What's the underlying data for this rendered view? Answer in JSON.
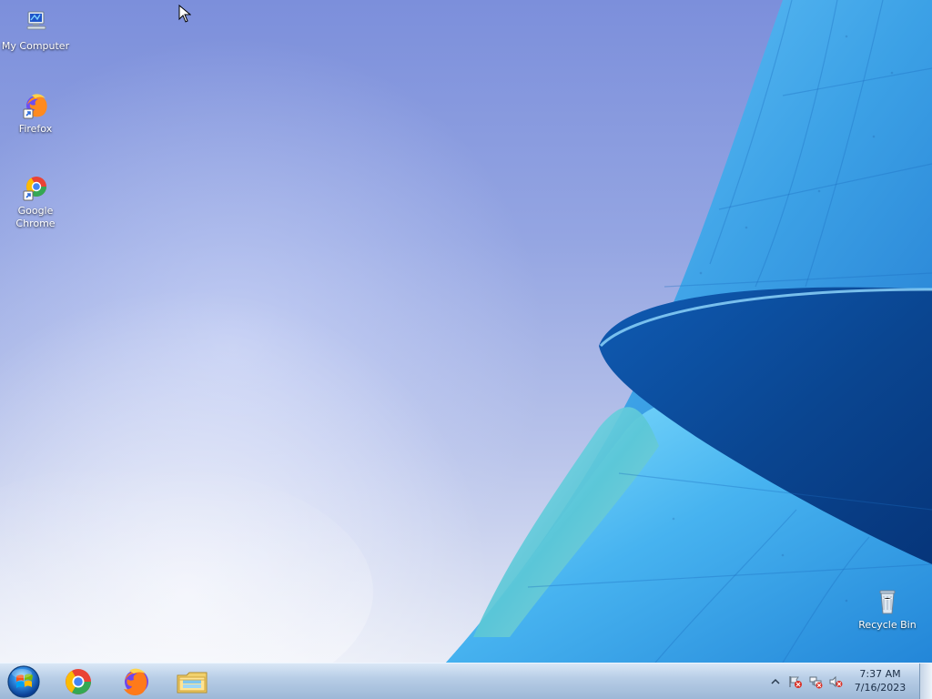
{
  "desktop": {
    "icons": [
      {
        "label": "My Computer",
        "icon": "computer-icon"
      },
      {
        "label": "Firefox",
        "icon": "firefox-icon"
      },
      {
        "label": "Google\nChrome",
        "icon": "chrome-icon"
      },
      {
        "label": "Recycle Bin",
        "icon": "recycle-bin-icon"
      }
    ]
  },
  "taskbar": {
    "start_icon": "windows-start-icon",
    "apps": [
      {
        "name": "Google Chrome",
        "icon": "chrome-icon"
      },
      {
        "name": "Firefox",
        "icon": "firefox-icon"
      },
      {
        "name": "File Explorer",
        "icon": "folder-icon"
      }
    ],
    "tray": {
      "time": "7:37 AM",
      "date": "7/16/2023",
      "icons": [
        "show-hidden-icons-icon",
        "action-center-error-icon",
        "network-error-icon",
        "speaker-muted-icon"
      ]
    }
  },
  "colors": {
    "sky_top": "#7c8fdb",
    "sky_bottom": "#eef1f8",
    "building_blue": "#3d9ee2",
    "building_dark": "#0c4d9f",
    "taskbar_top": "#d9e7f6",
    "taskbar_bottom": "#9db8d7"
  }
}
